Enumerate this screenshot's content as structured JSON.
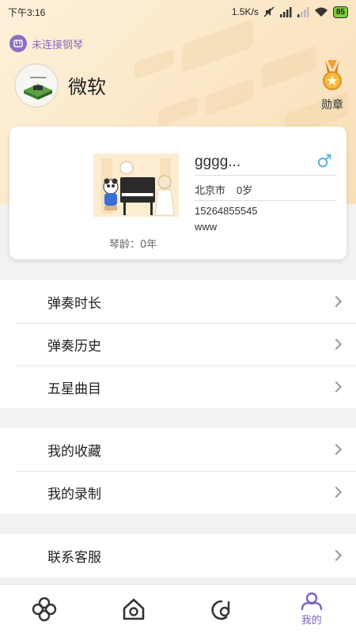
{
  "status_bar": {
    "time": "下午3:16",
    "network_speed": "1.5K/s",
    "battery": "85"
  },
  "header": {
    "connection_status": "未连接钢琴",
    "nickname": "微软",
    "medal_label": "勋章"
  },
  "profile": {
    "username": "gggg...",
    "gender_symbol": "♂",
    "city": "北京市",
    "age": "0岁",
    "phone": "15264855545",
    "extra": "www",
    "piano_age": "琴龄：0年"
  },
  "menu_groups": [
    {
      "items": [
        {
          "label": "弹奏时长"
        },
        {
          "label": "弹奏历史"
        },
        {
          "label": "五星曲目"
        }
      ]
    },
    {
      "items": [
        {
          "label": "我的收藏"
        },
        {
          "label": "我的录制"
        }
      ]
    },
    {
      "items": [
        {
          "label": "联系客服"
        }
      ]
    }
  ],
  "tabbar": {
    "tabs": [
      {
        "icon": "flower-icon",
        "label": ""
      },
      {
        "icon": "home-icon",
        "label": ""
      },
      {
        "icon": "music-disc-icon",
        "label": ""
      },
      {
        "icon": "profile-icon",
        "label": "我的",
        "active": true
      }
    ]
  },
  "colors": {
    "accent": "#7b63c0",
    "header_bg": "#fbe6c4",
    "gender": "#5ab0e0"
  }
}
